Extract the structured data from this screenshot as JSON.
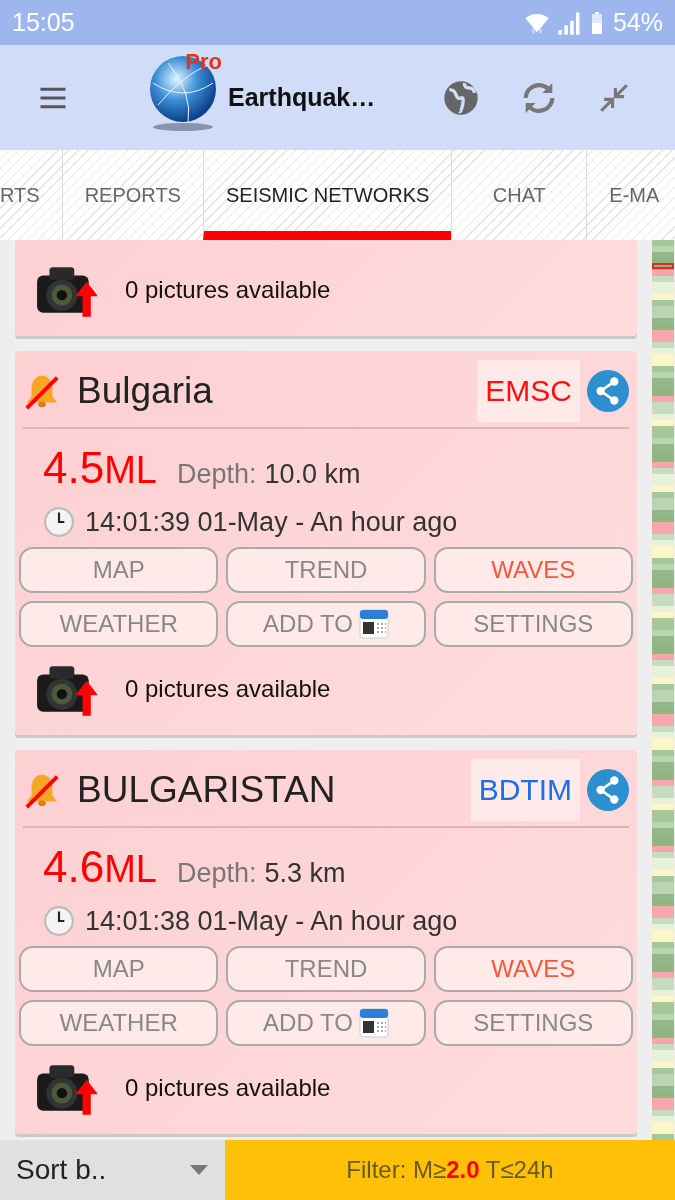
{
  "status_bar": {
    "time": "15:05",
    "battery": "54%"
  },
  "app_bar": {
    "logo_badge": "Pro",
    "title": "Earthquak…"
  },
  "tabs": [
    {
      "label": "RTS",
      "selected": false
    },
    {
      "label": "REPORTS",
      "selected": false
    },
    {
      "label": "SEISMIC NETWORKS",
      "selected": true
    },
    {
      "label": "CHAT",
      "selected": false
    },
    {
      "label": "E-MA",
      "selected": false
    }
  ],
  "events": [
    {
      "partial": true,
      "pictures": "0 pictures available"
    },
    {
      "partial": false,
      "alert_muted": true,
      "region": "Bulgaria",
      "source": "EMSC",
      "color": "#ff1010",
      "magnitude": "4.5",
      "scale": "ML",
      "depth_label": "Depth:",
      "depth": "10.0 km",
      "time": "14:01:39 01-May - An hour ago",
      "buttons": [
        {
          "label": "MAP",
          "kind": "text",
          "highlighted": false
        },
        {
          "label": "TREND",
          "kind": "text",
          "highlighted": false
        },
        {
          "label": "WAVES",
          "kind": "text",
          "highlighted": true
        },
        {
          "label": "WEATHER",
          "kind": "text",
          "highlighted": false
        },
        {
          "label": "ADD TO",
          "kind": "calendar",
          "highlighted": false
        },
        {
          "label": "SETTINGS",
          "kind": "text",
          "highlighted": false
        }
      ],
      "pictures": "0 pictures available"
    },
    {
      "partial": false,
      "alert_muted": true,
      "region": "BULGARISTAN",
      "source": "BDTIM",
      "color": "#1a6ee8",
      "magnitude": "4.6",
      "scale": "ML",
      "depth_label": "Depth:",
      "depth": "5.3 km",
      "time": "14:01:38 01-May - An hour ago",
      "buttons": [
        {
          "label": "MAP",
          "kind": "text",
          "highlighted": false
        },
        {
          "label": "TREND",
          "kind": "text",
          "highlighted": false
        },
        {
          "label": "WAVES",
          "kind": "text",
          "highlighted": true
        },
        {
          "label": "WEATHER",
          "kind": "text",
          "highlighted": false
        },
        {
          "label": "ADD TO",
          "kind": "calendar",
          "highlighted": false
        },
        {
          "label": "SETTINGS",
          "kind": "text",
          "highlighted": false
        }
      ],
      "pictures": "0 pictures available"
    }
  ],
  "bottom_bar": {
    "sort": "Sort b..",
    "filter": "Filter: M≥**2.0** T≤24h"
  }
}
